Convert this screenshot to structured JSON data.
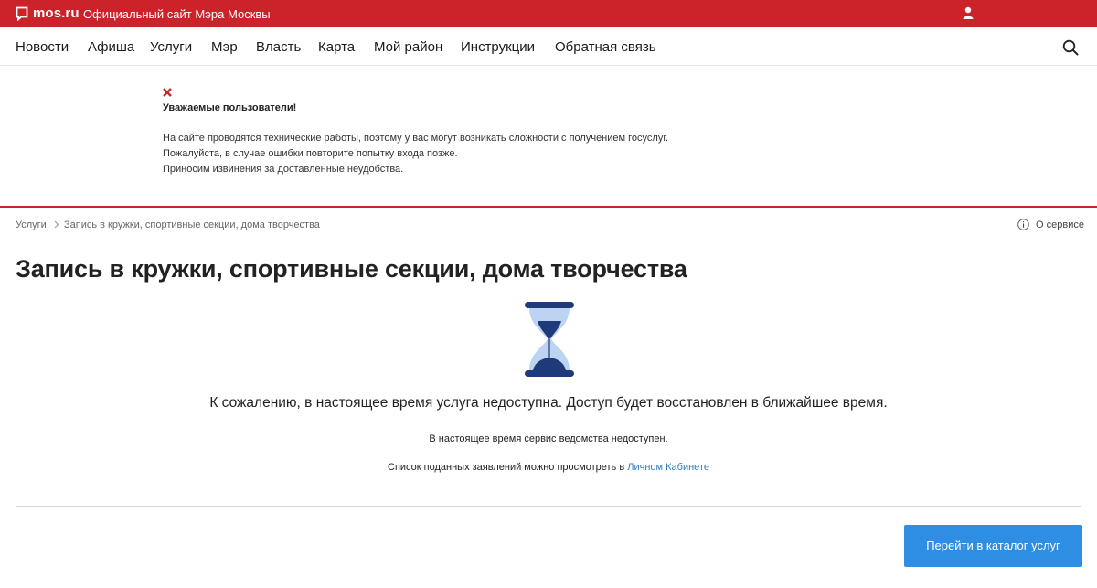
{
  "header": {
    "logo_text": "mos.ru",
    "subtitle": "Официальный сайт Мэра Москвы",
    "brand_color": "#cc2229"
  },
  "nav": {
    "items": [
      "Новости",
      "Афиша",
      "Услуги",
      "Мэр",
      "Власть",
      "Карта",
      "Мой район",
      "Инструкции",
      "Обратная связь"
    ]
  },
  "notice": {
    "title": "Уважаемые пользователи!",
    "lines": [
      "На сайте проводятся технические работы, поэтому у вас могут возникать сложности с получением госуслуг.",
      "Пожалуйста, в случае ошибки повторите попытку входа позже.",
      "Приносим извинения за доставленные неудобства."
    ]
  },
  "breadcrumb": {
    "items": [
      "Услуги",
      "Запись в кружки, спортивные секции, дома творчества"
    ],
    "about_label": "О сервисе"
  },
  "main": {
    "title": "Запись в кружки, спортивные секции, дома творчества",
    "unavailable_message": "К сожалению, в настоящее время услуга недоступна. Доступ будет восстановлен в ближайшее время.",
    "agency_message": "В настоящее время сервис ведомства недоступен.",
    "applications_prefix": "Список поданных заявлений можно просмотреть в",
    "applications_link": "Личном Кабинете",
    "catalog_button": "Перейти в каталог услуг"
  },
  "colors": {
    "accent": "#2d8ee3",
    "link": "#2f7fc1",
    "hourglass": "#1e3a7b"
  },
  "icons": [
    "logo-icon",
    "user-icon",
    "search-icon",
    "close-icon",
    "chevron-right-icon",
    "info-icon",
    "hourglass-icon"
  ]
}
